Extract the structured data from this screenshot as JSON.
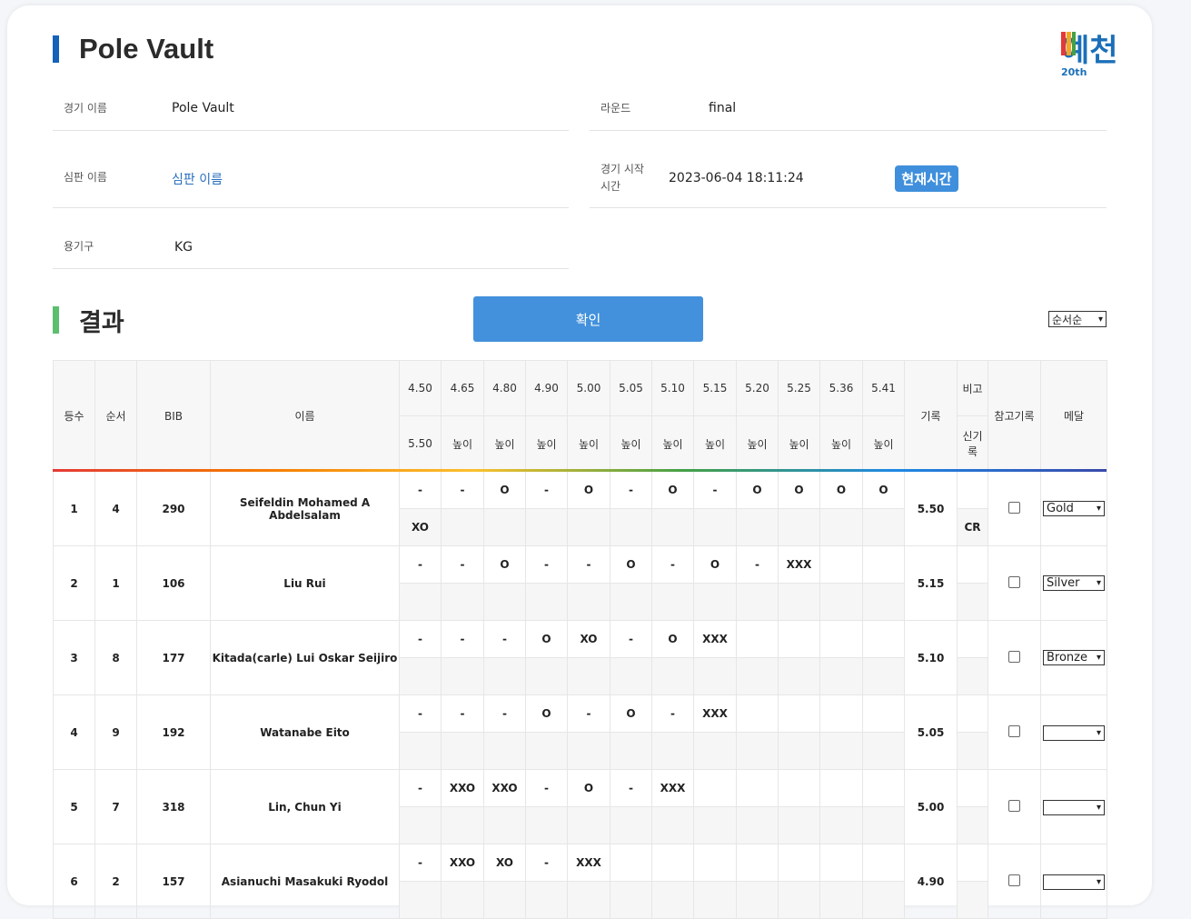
{
  "title": "Pole Vault",
  "logo": {
    "text": "예천",
    "sub": "20th"
  },
  "info": {
    "event_label": "경기 이름",
    "event_value": "Pole Vault",
    "round_label": "라운드",
    "round_value": "final",
    "judge_label": "심판 이름",
    "judge_value": "심판 이름",
    "start_label_1": "경기 시작",
    "start_label_2": "시간",
    "start_value": "2023-06-04 18:11:24",
    "now_button": "현재시간",
    "equip_label": "용기구",
    "equip_value": "KG"
  },
  "results": {
    "section_title": "결과",
    "confirm_button": "확인",
    "sort_value": "순서순",
    "headers": {
      "rank": "등수",
      "order": "순서",
      "bib": "BIB",
      "name": "이름",
      "record": "기록",
      "note_top": "비고",
      "note_bottom": "신기록",
      "ref": "참고기록",
      "medal": "메달"
    },
    "heights": [
      "4.50",
      "4.65",
      "4.80",
      "4.90",
      "5.00",
      "5.05",
      "5.10",
      "5.15",
      "5.20",
      "5.25",
      "5.36",
      "5.41"
    ],
    "sub_first": "5.50",
    "sub_label": "높이",
    "rows": [
      {
        "rank": "1",
        "order": "4",
        "bib": "290",
        "name": "Seifeldin Mohamed A Abdelsalam",
        "attempts": [
          "-",
          "-",
          "O",
          "-",
          "O",
          "-",
          "O",
          "-",
          "O",
          "O",
          "O",
          "O"
        ],
        "attempt2": "XO",
        "record": "5.50",
        "note": "CR",
        "medal": "Gold"
      },
      {
        "rank": "2",
        "order": "1",
        "bib": "106",
        "name": "Liu Rui",
        "attempts": [
          "-",
          "-",
          "O",
          "-",
          "-",
          "O",
          "-",
          "O",
          "-",
          "XXX",
          "",
          ""
        ],
        "attempt2": "",
        "record": "5.15",
        "note": "",
        "medal": "Silver"
      },
      {
        "rank": "3",
        "order": "8",
        "bib": "177",
        "name": "Kitada(carle) Lui Oskar Seijiro",
        "attempts": [
          "-",
          "-",
          "-",
          "O",
          "XO",
          "-",
          "O",
          "XXX",
          "",
          "",
          "",
          ""
        ],
        "attempt2": "",
        "record": "5.10",
        "note": "",
        "medal": "Bronze"
      },
      {
        "rank": "4",
        "order": "9",
        "bib": "192",
        "name": "Watanabe Eito",
        "attempts": [
          "-",
          "-",
          "-",
          "O",
          "-",
          "O",
          "-",
          "XXX",
          "",
          "",
          "",
          ""
        ],
        "attempt2": "",
        "record": "5.05",
        "note": "",
        "medal": ""
      },
      {
        "rank": "5",
        "order": "7",
        "bib": "318",
        "name": "Lin, Chun Yi",
        "attempts": [
          "-",
          "XXO",
          "XXO",
          "-",
          "O",
          "-",
          "XXX",
          "",
          "",
          "",
          "",
          ""
        ],
        "attempt2": "",
        "record": "5.00",
        "note": "",
        "medal": ""
      },
      {
        "rank": "6",
        "order": "2",
        "bib": "157",
        "name": "Asianuchi Masakuki Ryodol",
        "attempts": [
          "-",
          "XXO",
          "XO",
          "-",
          "XXX",
          "",
          "",
          "",
          "",
          "",
          "",
          ""
        ],
        "attempt2": "",
        "record": "4.90",
        "note": "",
        "medal": ""
      }
    ]
  }
}
